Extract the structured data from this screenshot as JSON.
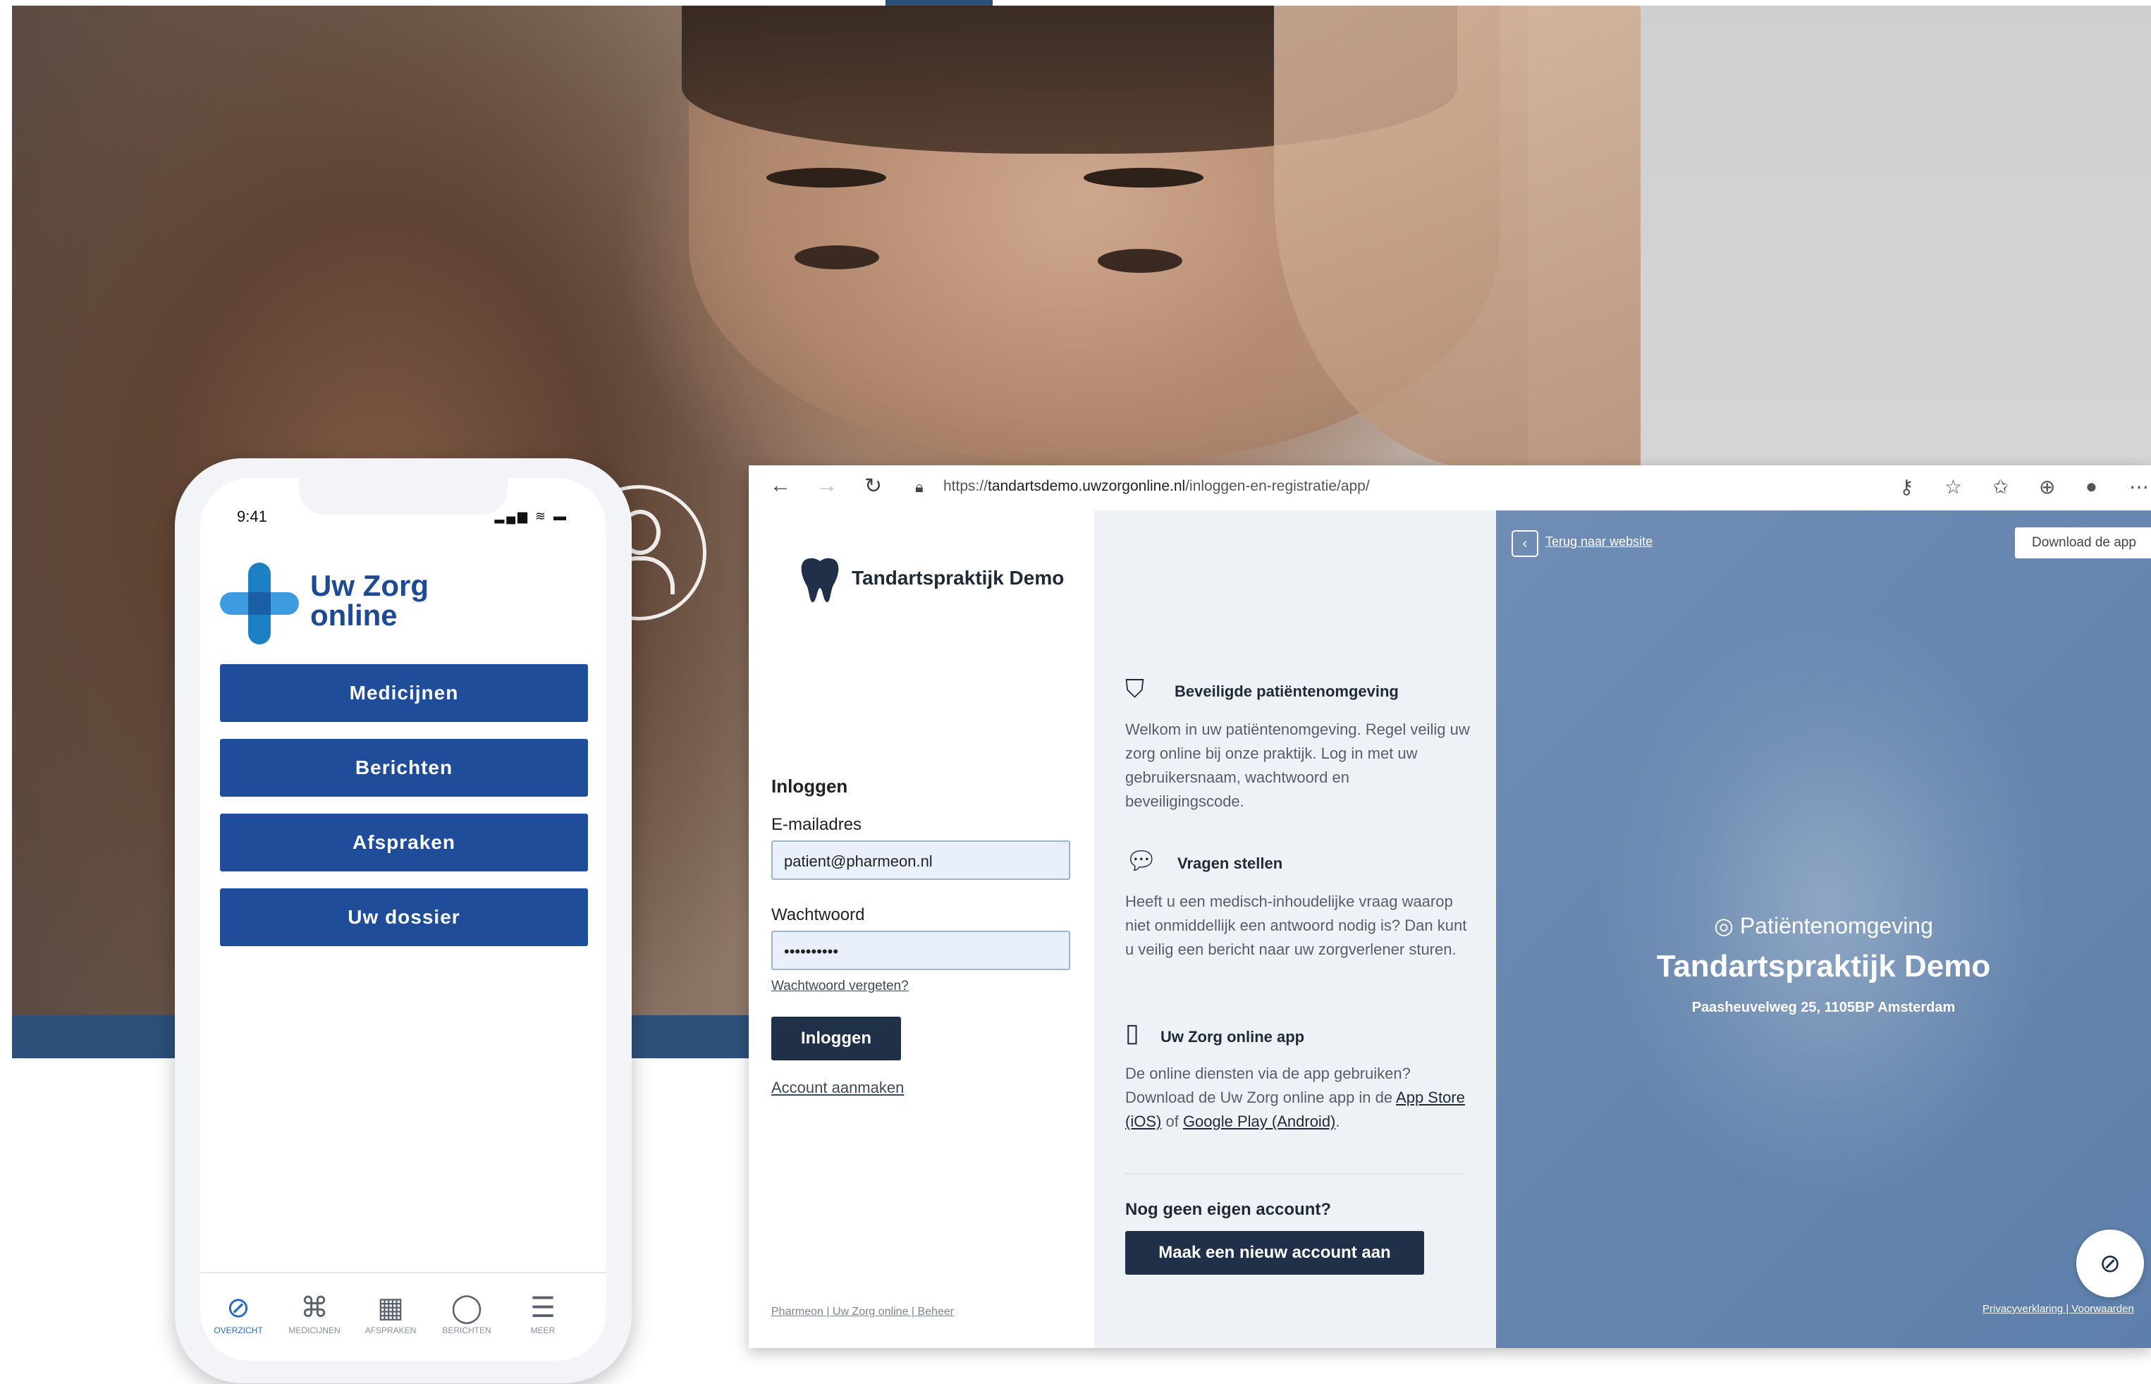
{
  "phone": {
    "time": "9:41",
    "status_icons": "▂▄▆ ≋ ▬",
    "logo_line1": "Uw Zorg",
    "logo_line2": "online",
    "buttons": [
      "Medicijnen",
      "Berichten",
      "Afspraken",
      "Uw dossier"
    ],
    "nav": [
      {
        "label": "OVERZICHT",
        "icon": "compass-icon",
        "glyph": "⊘",
        "active": true
      },
      {
        "label": "MEDICIJNEN",
        "icon": "pills-icon",
        "glyph": "⌘",
        "active": false
      },
      {
        "label": "AFSPRAKEN",
        "icon": "calendar-icon",
        "glyph": "▦",
        "active": false
      },
      {
        "label": "BERICHTEN",
        "icon": "chat-icon",
        "glyph": "◯",
        "active": false
      },
      {
        "label": "MEER",
        "icon": "menu-icon",
        "glyph": "☰",
        "active": false
      }
    ]
  },
  "browser": {
    "url_prefix": "https://",
    "url_domain": "tandartsdemo.uwzorgonline.nl",
    "url_path": "/inloggen-en-registratie/app/",
    "practice_name": "Tandartspraktijk Demo",
    "login": {
      "heading": "Inloggen",
      "email_label": "E-mailadres",
      "email_value": "patient@pharmeon.nl",
      "password_label": "Wachtwoord",
      "password_value": "••••••••••",
      "forgot_link": "Wachtwoord vergeten?",
      "submit": "Inloggen",
      "create_link": "Account aanmaken"
    },
    "footer_left": "Pharmeon | Uw Zorg online | Beheer",
    "info": {
      "secure_title": "Beveiligde patiëntenomgeving",
      "secure_text": "Welkom in uw patiëntenomgeving. Regel veilig uw zorg online bij onze praktijk. Log in met uw gebruikersnaam, wachtwoord en beveiligingscode.",
      "questions_title": "Vragen stellen",
      "questions_text": "Heeft u een medisch-inhoudelijke vraag waarop niet onmiddellijk een antwoord nodig is? Dan kunt u veilig een bericht naar uw zorgverlener sturen.",
      "app_title": "Uw Zorg online app",
      "app_text_1": "De online diensten via de app gebruiken? Download de Uw Zorg online app in de",
      "app_link_ios": "App Store (iOS)",
      "app_text_2": "of",
      "app_link_android": "Google Play (Android)",
      "app_text_3": ".",
      "no_account": "Nog geen eigen account?",
      "new_account_btn": "Maak een nieuw account aan"
    },
    "right": {
      "back_link": "Terug naar website",
      "download_btn": "Download de app",
      "env_label": "Patiëntenomgeving",
      "practice_title": "Tandartspraktijk Demo",
      "address": "Paasheuvelweg 25, 1105BP Amsterdam",
      "footer": "Privacyverklaring | Voorwaarden"
    }
  },
  "colors": {
    "primary_blue": "#1f4d9a",
    "dark_navy": "#1f3048",
    "panel_blue": "#6f8db4",
    "band_blue": "#2c5079"
  }
}
